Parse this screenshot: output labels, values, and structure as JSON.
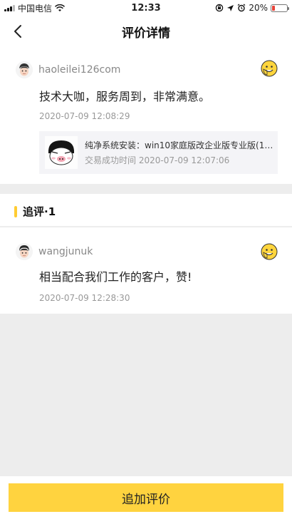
{
  "status_bar": {
    "carrier": "中国电信",
    "time": "12:33",
    "battery": "20%",
    "battery_level": 0.2
  },
  "nav": {
    "title": "评价详情"
  },
  "review": {
    "username": "haoleilei126com",
    "text": "技术大咖，服务周到，非常满意。",
    "time": "2020-07-09 12:08:29",
    "order": {
      "title": "纯净系统安装：win10家庭版改企业版专业版(170...",
      "meta_label": "交易成功时间",
      "meta_time": "2020-07-09 12:07:06"
    }
  },
  "followup": {
    "header": "追评·1",
    "username": "wangjunuk",
    "text": "相当配合我们工作的客户，赞!",
    "time": "2020-07-09 12:28:30"
  },
  "bottom": {
    "add_review_label": "追加评价"
  },
  "colors": {
    "accent": "#ffd33f",
    "background": "#ededed"
  }
}
